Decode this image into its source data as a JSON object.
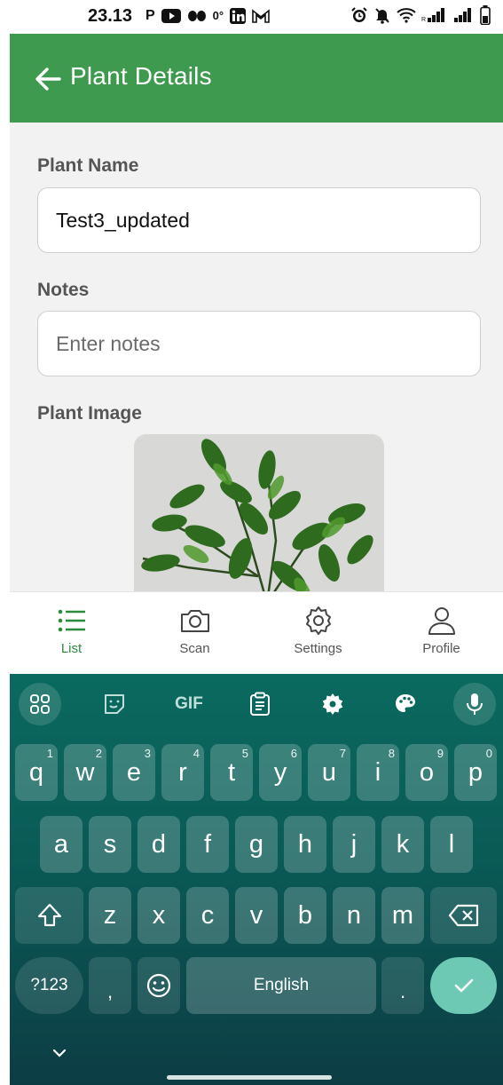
{
  "status_bar": {
    "time": "23.13",
    "left_glyphs": [
      "P",
      "0°",
      "M"
    ],
    "icons": [
      "youtube-icon",
      "butterfly-icon",
      "linkedin-icon",
      "gmail-icon",
      "alarm-icon",
      "mute-icon",
      "wifi-icon",
      "signal-icon",
      "signal-icon",
      "battery-icon"
    ]
  },
  "app_bar": {
    "title": "Plant Details",
    "back_icon": "arrow-left-icon"
  },
  "form": {
    "name_label": "Plant Name",
    "name_value": "Test3_updated",
    "notes_label": "Notes",
    "notes_placeholder": "Enter notes",
    "image_label": "Plant Image"
  },
  "bottom_nav": {
    "items": [
      {
        "label": "List",
        "icon": "list-icon",
        "active": true
      },
      {
        "label": "Scan",
        "icon": "camera-icon",
        "active": false
      },
      {
        "label": "Settings",
        "icon": "gear-icon",
        "active": false
      },
      {
        "label": "Profile",
        "icon": "person-icon",
        "active": false
      }
    ]
  },
  "keyboard": {
    "toolbar": [
      "apps-icon",
      "sticker-icon",
      "GIF",
      "clipboard-icon",
      "gear-icon",
      "palette-icon",
      "microphone-icon"
    ],
    "row1": [
      "q",
      "w",
      "e",
      "r",
      "t",
      "y",
      "u",
      "i",
      "o",
      "p"
    ],
    "row1_hints": [
      "1",
      "2",
      "3",
      "4",
      "5",
      "6",
      "7",
      "8",
      "9",
      "0"
    ],
    "row2": [
      "a",
      "s",
      "d",
      "f",
      "g",
      "h",
      "j",
      "k",
      "l"
    ],
    "row3": [
      "z",
      "x",
      "c",
      "v",
      "b",
      "n",
      "m"
    ],
    "symbols_key": "?123",
    "comma_key": ",",
    "space_label": "English",
    "period_key": ".",
    "collapse_icon": "chevron-down-icon"
  },
  "colors": {
    "app_bar": "#3e9a4f",
    "active_nav": "#2e8b3e",
    "keyboard": "#0a5a56",
    "enter_key": "#6ec9b4"
  }
}
